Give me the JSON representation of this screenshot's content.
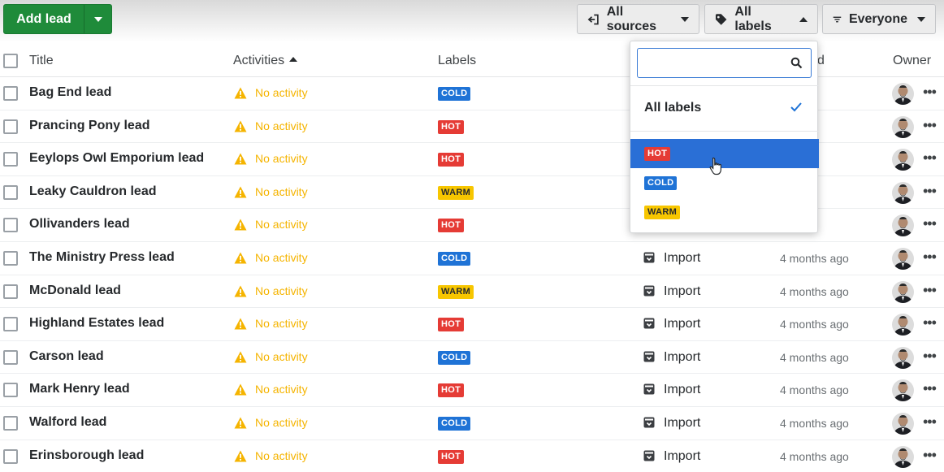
{
  "toolbar": {
    "add_lead_label": "Add lead",
    "sources_label": "All sources",
    "labels_label": "All labels",
    "owner_label": "Everyone"
  },
  "columns": {
    "title": "Title",
    "activities": "Activities",
    "labels": "Labels",
    "created_partial": "d",
    "owner": "Owner"
  },
  "rows": [
    {
      "title": "Bag End lead",
      "activity": "No activity",
      "label": "COLD",
      "source": "",
      "time": "ns ago"
    },
    {
      "title": "Prancing Pony lead",
      "activity": "No activity",
      "label": "HOT",
      "source": "",
      "time": "ns ago"
    },
    {
      "title": "Eeylops Owl Emporium lead",
      "activity": "No activity",
      "label": "HOT",
      "source": "",
      "time": "ns ago"
    },
    {
      "title": "Leaky Cauldron lead",
      "activity": "No activity",
      "label": "WARM",
      "source": "",
      "time": "ns ago"
    },
    {
      "title": "Ollivanders lead",
      "activity": "No activity",
      "label": "HOT",
      "source": "",
      "time": "ns ago"
    },
    {
      "title": "The Ministry Press lead",
      "activity": "No activity",
      "label": "COLD",
      "source": "Import",
      "time": "4 months ago"
    },
    {
      "title": "McDonald lead",
      "activity": "No activity",
      "label": "WARM",
      "source": "Import",
      "time": "4 months ago"
    },
    {
      "title": "Highland Estates lead",
      "activity": "No activity",
      "label": "HOT",
      "source": "Import",
      "time": "4 months ago"
    },
    {
      "title": "Carson lead",
      "activity": "No activity",
      "label": "COLD",
      "source": "Import",
      "time": "4 months ago"
    },
    {
      "title": "Mark Henry lead",
      "activity": "No activity",
      "label": "HOT",
      "source": "Import",
      "time": "4 months ago"
    },
    {
      "title": "Walford lead",
      "activity": "No activity",
      "label": "COLD",
      "source": "Import",
      "time": "4 months ago"
    },
    {
      "title": "Erinsborough lead",
      "activity": "No activity",
      "label": "HOT",
      "source": "Import",
      "time": "4 months ago"
    }
  ],
  "dropdown": {
    "search_value": "",
    "all_labels": "All labels",
    "items": [
      "HOT",
      "COLD",
      "WARM"
    ],
    "selected_index": 0
  },
  "colors": {
    "hot": "#e53b35",
    "cold": "#1f73d6",
    "warm": "#f7c600",
    "primary_green": "#1f8b3a",
    "selected_blue": "#2a6fd6",
    "warning_yellow": "#f5b400"
  },
  "icons": {
    "sources": "source-arrow-icon",
    "labels": "tag-icon",
    "owner": "filter-lines-icon",
    "activity": "warning-icon",
    "source_row": "import-box-icon",
    "search": "search-icon",
    "check": "check-icon"
  }
}
